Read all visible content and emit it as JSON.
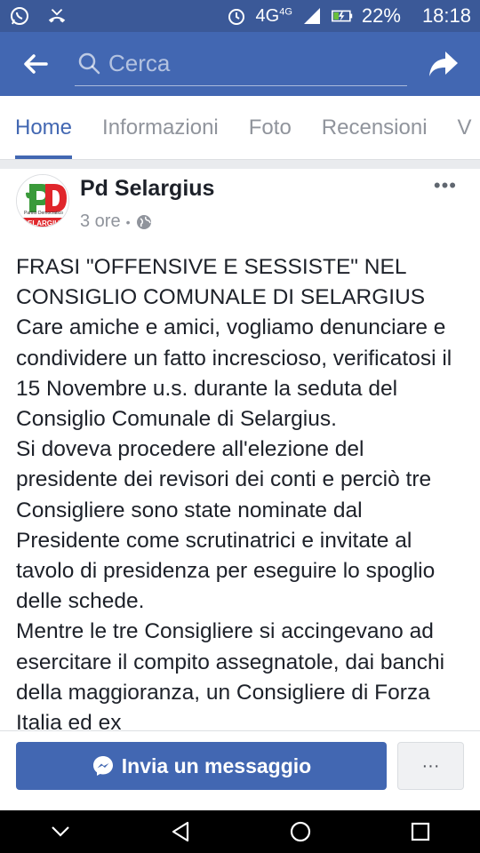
{
  "status_bar": {
    "network": "4G",
    "network_sup": "4G",
    "battery": "22%",
    "time": "18:18",
    "icons": [
      "whatsapp-icon",
      "missed-call-icon",
      "alarm-icon",
      "signal-icon",
      "battery-charging-icon"
    ]
  },
  "header": {
    "search_placeholder": "Cerca"
  },
  "tabs": [
    {
      "label": "Home",
      "active": true
    },
    {
      "label": "Informazioni"
    },
    {
      "label": "Foto"
    },
    {
      "label": "Recensioni"
    },
    {
      "label": "V"
    }
  ],
  "post": {
    "page_name": "Pd Selargius",
    "time": "3 ore",
    "separator": "•",
    "avatar": {
      "text_top": "Partito Democratico",
      "text_bottom": "SELARGIUS"
    },
    "more_label": "•••",
    "paragraphs": [
      "FRASI \"OFFENSIVE E SESSISTE\" NEL CONSIGLIO COMUNALE DI SELARGIUS",
      "Care amiche e amici, vogliamo denunciare e condividere un fatto increscioso, verificatosi il 15 Novembre u.s. durante la seduta del Consiglio Comunale di Selargius.",
      "Si doveva procedere all'elezione del presidente dei revisori dei conti e perciò tre Consigliere sono state nominate dal Presidente come scrutinatrici e invitate al tavolo di presidenza per eseguire lo spoglio delle schede.",
      "Mentre le tre Consigliere si accingevano ad esercitare il compito assegnatole, dai banchi della maggioranza, un Consigliere di Forza Italia ed ex"
    ]
  },
  "actions": {
    "message_button": "Invia un messaggio",
    "more_button": "···"
  },
  "colors": {
    "brand": "#4267b2",
    "status_bar": "#3b5998"
  }
}
